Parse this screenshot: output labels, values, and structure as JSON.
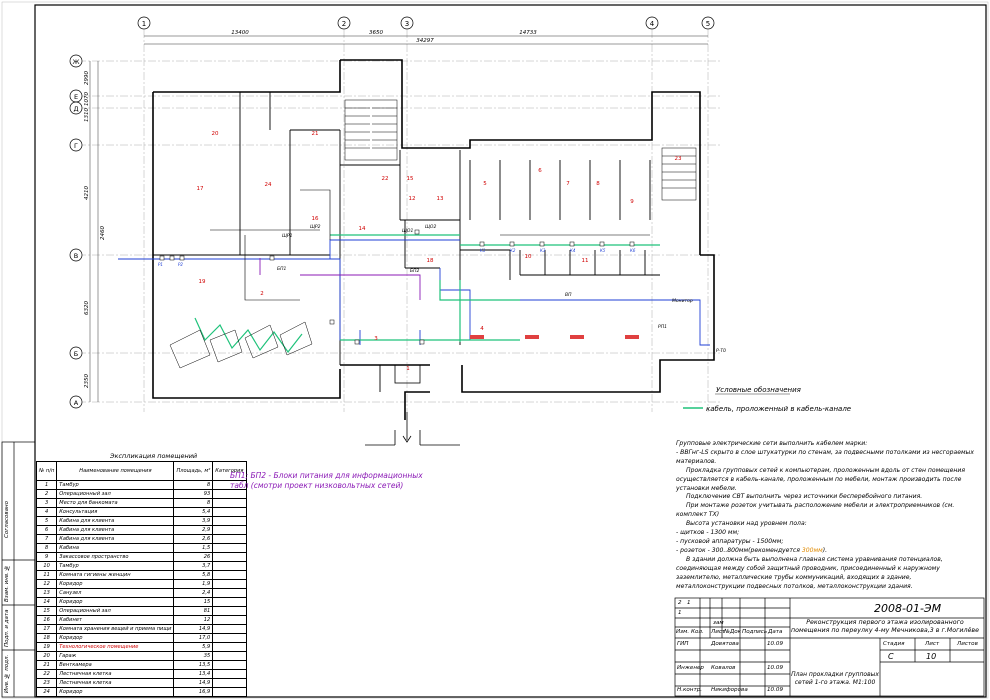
{
  "sheet_code": "2008-01-ЭМ",
  "project_description": "Реконструкция первого этажа изолированного помещения по переулку 4-му Мечникова,3 в г.Могилёве",
  "drawing_title": "План прокладки групповых сетей 1-го этажа. М1:100",
  "stage_header": "Стадия",
  "sheet_header": "Лист",
  "sheets_header": "Листов",
  "stage_value": "С",
  "sheet_value": "10",
  "columns_header": [
    "Изм.",
    "Кол.",
    "Лист",
    "№Док",
    "Подпись",
    "Дата"
  ],
  "revision_rows": [
    [
      "2",
      "1"
    ],
    [
      "1",
      "",
      "зам"
    ]
  ],
  "signers": [
    {
      "role": "ГИП",
      "name": "Довятова",
      "date": "10.09"
    },
    {
      "role": "Инженер",
      "name": "Ковалов",
      "date": "10.09"
    },
    {
      "role": "Н.контр.",
      "name": "Никифорова",
      "date": "10.09"
    }
  ],
  "axes_top": [
    "1",
    "2",
    "3",
    "4",
    "5"
  ],
  "axes_left": [
    "Ж",
    "Е",
    "Д",
    "Г",
    "В",
    "Б",
    "А"
  ],
  "dims_top": [
    "13400",
    "3650",
    "14733",
    "34297"
  ],
  "dims_left": [
    "2990",
    "1070",
    "1310",
    "4210",
    "2460",
    "6320",
    "2350"
  ],
  "explication": {
    "title": "Экспликация помещений",
    "headers": [
      "№ п/п",
      "Наименование помещения",
      "Площадь, м²",
      "Категория"
    ],
    "rows": [
      {
        "n": "1",
        "name": "Тамбур",
        "area": "8",
        "bold": true
      },
      {
        "n": "2",
        "name": "Операционный зал",
        "area": "93",
        "bold": true
      },
      {
        "n": "3",
        "name": "Место для банкомата",
        "area": "8"
      },
      {
        "n": "4",
        "name": "Консультация",
        "area": "5,4",
        "bold": true
      },
      {
        "n": "5",
        "name": "Кабина для клиента",
        "area": "3,9"
      },
      {
        "n": "6",
        "name": "Кабина для клиента",
        "area": "2,9"
      },
      {
        "n": "7",
        "name": "Кабина для клиента",
        "area": "2,6"
      },
      {
        "n": "8",
        "name": "Кабина",
        "area": "1,5"
      },
      {
        "n": "9",
        "name": "Закассовое пространство",
        "area": "26"
      },
      {
        "n": "10",
        "name": "Тамбур",
        "area": "3,7"
      },
      {
        "n": "11",
        "name": "Комната гигиены женщин",
        "area": "5,8"
      },
      {
        "n": "12",
        "name": "Коридор",
        "area": "1,9"
      },
      {
        "n": "13",
        "name": "Санузел",
        "area": "2,4"
      },
      {
        "n": "14",
        "name": "Коридор",
        "area": "15"
      },
      {
        "n": "15",
        "name": "Операционный зал",
        "area": "81"
      },
      {
        "n": "16",
        "name": "Кабинет",
        "area": "12"
      },
      {
        "n": "17",
        "name": "Комната хранения вещей и приема пищи",
        "area": "14,9"
      },
      {
        "n": "18",
        "name": "Коридор",
        "area": "17,0"
      },
      {
        "n": "19",
        "name": "Технологическое помещение",
        "area": "5,9",
        "red": true
      },
      {
        "n": "20",
        "name": "Гараж",
        "area": "35"
      },
      {
        "n": "21",
        "name": "Венткамера",
        "area": "13,5"
      },
      {
        "n": "22",
        "name": "Лестничная клетка",
        "area": "13,4"
      },
      {
        "n": "23",
        "name": "Лестничная клетка",
        "area": "14,9"
      },
      {
        "n": "24",
        "name": "Коридор",
        "area": "16,9"
      }
    ]
  },
  "bp_note": "БП1; БП2 - Блоки питания для информационных табл (смотри проект низковольтных сетей)",
  "legend": {
    "title": "Условные обозначения",
    "item": "кабель, проложенный в кабель-канале",
    "color": "#1ec27a"
  },
  "notes": [
    "Групповые электрические сети выполнить кабелем марки:",
    "- ВВГнг-LS скрыто в слое штукатурки по стенам, за подвесными потолками из несгораемых материалов.",
    "Прокладка групповых сетей к компьютерам, проложенным вдоль от стен помещения осуществляется в кабель-канале, проложенным по мебели, монтаж производить после установки мебели.",
    "Подключение СВТ выполнить через источники бесперебойного питания.",
    "При монтаже розеток учитывать расположение мебели и электроприемников (см. комплект ТХ)",
    "Высота установки над уровнем пола:",
    "- щитков - 1300 мм;",
    "- пусковой аппаратуры - 1500мм;",
    "- розеток - 300..800мм(рекомендуется 300мм).",
    "В здании должна быть выполнена главная система уравнивания потенциалов, соединяющая между собой защитный проводник, присоединенный к наружному заземлителю, металлические трубы коммуникаций, входящих в здание, металлоконструкции подвесных потолков, металлоконструкции здания."
  ],
  "side_labels": [
    "Согласовано",
    "Взам. инв. №",
    "Подп. и дата",
    "Инв. № подл."
  ],
  "room_numbers": [
    "20",
    "21",
    "17",
    "24",
    "16",
    "19",
    "14",
    "18",
    "22",
    "12",
    "1",
    "2",
    "3",
    "4",
    "5",
    "6",
    "7",
    "8",
    "9",
    "10",
    "11",
    "13",
    "15",
    "23"
  ],
  "panel_labels": [
    "ЩР1",
    "ЩР2",
    "ЩО1",
    "ЩО2",
    "БП1",
    "БП2",
    "Монитор",
    "ВП",
    "РП1",
    "Р-Т0"
  ],
  "colors": {
    "cable_green": "#1ec27a",
    "cable_blue": "#1f3fd6",
    "cable_purple": "#8b1ab6",
    "room_number": "#d00000",
    "highlight": "#e08a00"
  }
}
